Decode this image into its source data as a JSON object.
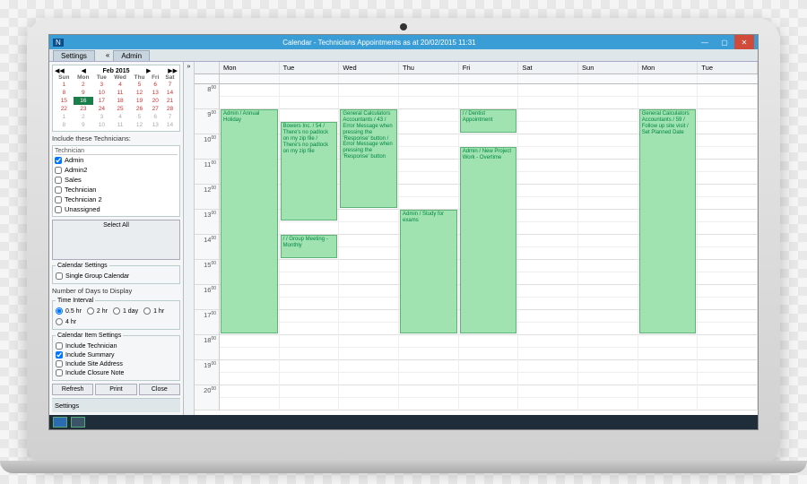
{
  "window": {
    "title": "Calendar - Technicians Appointments as at 20/02/2015 11:31",
    "min": "—",
    "max": "▢",
    "close": "✕"
  },
  "toolbar": {
    "settings_tab": "Settings",
    "admin_tab": "Admin",
    "expand": "»",
    "collapse": "«"
  },
  "mini_cal": {
    "month_label": "Feb 2015",
    "first": "◀◀",
    "prev": "◀",
    "next": "▶",
    "last": "▶▶",
    "dow": [
      "Sun",
      "Mon",
      "Tue",
      "Wed",
      "Thu",
      "Fri",
      "Sat"
    ],
    "weeks": [
      [
        {
          "d": "1"
        },
        {
          "d": "2"
        },
        {
          "d": "3"
        },
        {
          "d": "4"
        },
        {
          "d": "5"
        },
        {
          "d": "6"
        },
        {
          "d": "7"
        }
      ],
      [
        {
          "d": "8"
        },
        {
          "d": "9"
        },
        {
          "d": "10"
        },
        {
          "d": "11"
        },
        {
          "d": "12"
        },
        {
          "d": "13"
        },
        {
          "d": "14"
        }
      ],
      [
        {
          "d": "15"
        },
        {
          "d": "16",
          "today": true
        },
        {
          "d": "17"
        },
        {
          "d": "18"
        },
        {
          "d": "19"
        },
        {
          "d": "20"
        },
        {
          "d": "21"
        }
      ],
      [
        {
          "d": "22"
        },
        {
          "d": "23"
        },
        {
          "d": "24"
        },
        {
          "d": "25"
        },
        {
          "d": "26"
        },
        {
          "d": "27"
        },
        {
          "d": "28"
        }
      ],
      [
        {
          "d": "1",
          "other": true
        },
        {
          "d": "2",
          "other": true
        },
        {
          "d": "3",
          "other": true
        },
        {
          "d": "4",
          "other": true
        },
        {
          "d": "5",
          "other": true
        },
        {
          "d": "6",
          "other": true
        },
        {
          "d": "7",
          "other": true
        }
      ],
      [
        {
          "d": "8",
          "other": true
        },
        {
          "d": "9",
          "other": true
        },
        {
          "d": "10",
          "other": true
        },
        {
          "d": "11",
          "other": true
        },
        {
          "d": "12",
          "other": true
        },
        {
          "d": "13",
          "other": true
        },
        {
          "d": "14",
          "other": true
        }
      ]
    ]
  },
  "tech": {
    "label": "Include these Technicians:",
    "header": "Technician",
    "items": [
      {
        "name": "Admin",
        "checked": true
      },
      {
        "name": "Admin2",
        "checked": false
      },
      {
        "name": "Sales",
        "checked": false
      },
      {
        "name": "Technician",
        "checked": false
      },
      {
        "name": "Technician 2",
        "checked": false
      },
      {
        "name": "Unassigned",
        "checked": false
      }
    ],
    "select_all": "Select All"
  },
  "cal_settings": {
    "legend": "Calendar Settings",
    "single_group": "Single Group Calendar",
    "days_label": "Number of Days to Display"
  },
  "time_interval": {
    "legend": "Time Interval",
    "opts": [
      "0.5 hr",
      "2 hr",
      "1 day",
      "1 hr",
      "4 hr"
    ],
    "selected": 0
  },
  "item_settings": {
    "legend": "Calendar Item Settings",
    "opts": [
      {
        "label": "Include Technician",
        "checked": false
      },
      {
        "label": "Include Summary",
        "checked": true
      },
      {
        "label": "Include Site Address",
        "checked": false
      },
      {
        "label": "Include Closure Note",
        "checked": false
      }
    ]
  },
  "buttons": {
    "refresh": "Refresh",
    "print": "Print",
    "close": "Close"
  },
  "footer": {
    "settings": "Settings"
  },
  "days": [
    "Mon",
    "Tue",
    "Wed",
    "Thu",
    "Fri",
    "Sat",
    "Sun",
    "Mon",
    "Tue"
  ],
  "hours": [
    "8",
    "9",
    "10",
    "11",
    "12",
    "13",
    "14",
    "15",
    "16",
    "17",
    "18",
    "19",
    "20"
  ],
  "events": [
    {
      "day": 0,
      "start": 9,
      "end": 18,
      "text": "Admin / Annual Holiday"
    },
    {
      "day": 1,
      "start": 9.5,
      "end": 13.5,
      "text": "Bowers Inc. / 54 / There's no padlock on my zip file / There's no padlock on my zip file"
    },
    {
      "day": 1,
      "start": 14,
      "end": 15,
      "text": " /  / Group Meeting - Monthly"
    },
    {
      "day": 2,
      "start": 9,
      "end": 13,
      "text": "General Calculators Accountants / 43 / Error Message when pressing the 'Response' button / Error Message when pressing the 'Response' button"
    },
    {
      "day": 3,
      "start": 13,
      "end": 18,
      "text": "Admin / Study for exams"
    },
    {
      "day": 4,
      "start": 9,
      "end": 10,
      "text": " /  / Dentist Appointment"
    },
    {
      "day": 4,
      "start": 10.5,
      "end": 18,
      "text": "Admin / New Project Work - Overtime"
    },
    {
      "day": 7,
      "start": 9,
      "end": 18,
      "text": "General Calculators Accountants / 59 / Follow up site visit / Set Planned Date"
    }
  ],
  "colors": {
    "event_bg": "#a0e2b0",
    "event_border": "#5cb576",
    "titlebar": "#3b9dd6"
  }
}
